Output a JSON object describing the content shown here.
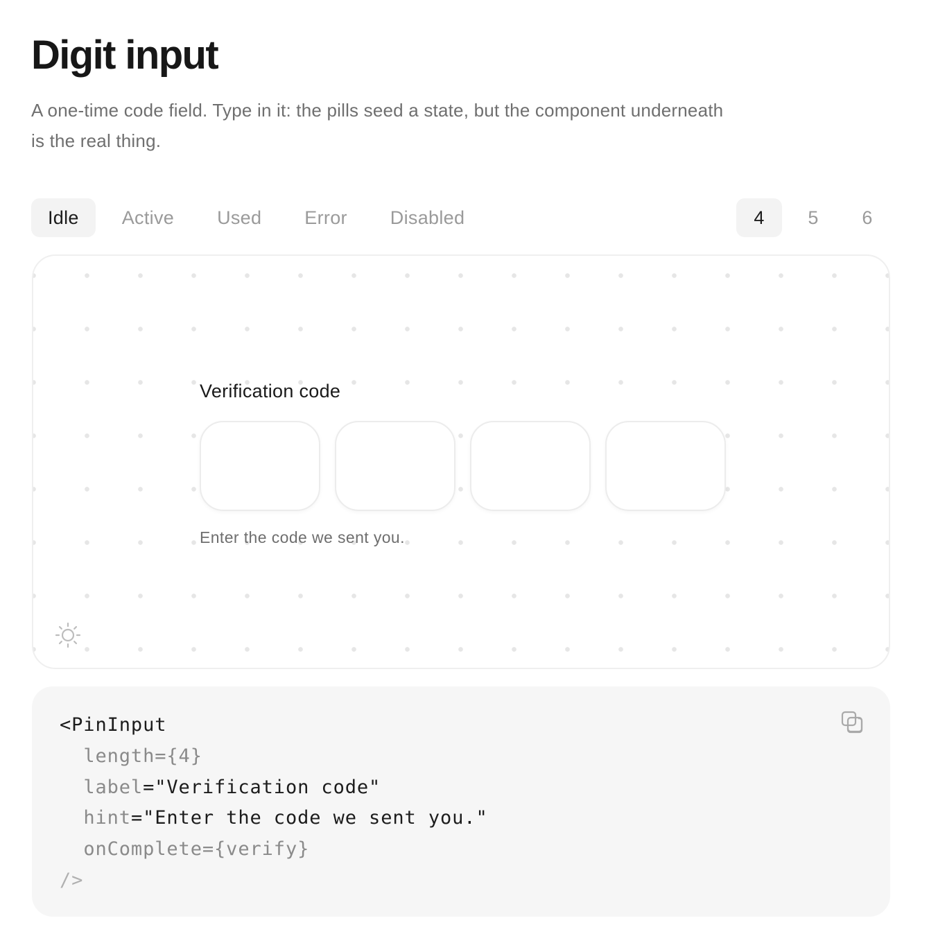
{
  "header": {
    "title": "Digit input",
    "description": "A one-time code field. Type in it: the pills seed a state, but the component underneath is the real thing."
  },
  "state_tabs": [
    {
      "label": "Idle",
      "selected": true
    },
    {
      "label": "Active",
      "selected": false
    },
    {
      "label": "Used",
      "selected": false
    },
    {
      "label": "Error",
      "selected": false
    },
    {
      "label": "Disabled",
      "selected": false
    }
  ],
  "length_tabs": [
    {
      "label": "4",
      "selected": true
    },
    {
      "label": "5",
      "selected": false
    },
    {
      "label": "6",
      "selected": false
    }
  ],
  "preview": {
    "label": "Verification code",
    "hint": "Enter the code we sent you.",
    "digits": [
      "",
      "",
      "",
      ""
    ],
    "theme_icon": "sun-icon"
  },
  "code": {
    "open_tag": "<PinInput",
    "attrs": [
      {
        "name": "length",
        "eq": "=",
        "value": "{4}",
        "value_style": "punct"
      },
      {
        "name": "label",
        "eq": "=",
        "value": "\"Verification code\"",
        "value_style": "str"
      },
      {
        "name": "hint",
        "eq": "=",
        "value": "\"Enter the code we sent you.\"",
        "value_style": "str"
      },
      {
        "name": "onComplete",
        "eq": "=",
        "value": "{verify}",
        "value_style": "punct"
      }
    ],
    "close_tag": "/>",
    "copy_icon": "copy-icon"
  },
  "colors": {
    "text": "#171717",
    "muted": "#6f6f6f",
    "pill_selected_bg": "#f3f3f3",
    "code_bg": "#f6f6f6"
  }
}
